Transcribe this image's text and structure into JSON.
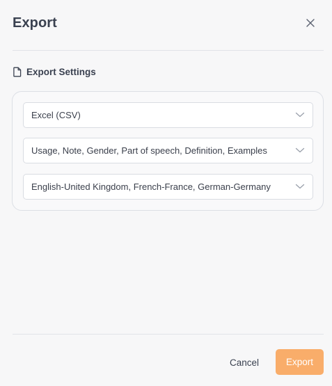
{
  "dialog": {
    "title": "Export",
    "close_icon": "close-icon"
  },
  "settings": {
    "section_title": "Export Settings",
    "section_icon": "document-icon",
    "format": {
      "value": "Excel (CSV)"
    },
    "fields": {
      "value": "Usage, Note, Gender, Part of speech, Definition, Examples"
    },
    "languages": {
      "value": "English-United Kingdom, French-France, German-Germany"
    }
  },
  "footer": {
    "cancel_label": "Cancel",
    "export_label": "Export"
  },
  "colors": {
    "accent": "#f9ad6a",
    "background": "#f7f7f8",
    "border": "#dcdfe5",
    "text": "#3a4150"
  }
}
